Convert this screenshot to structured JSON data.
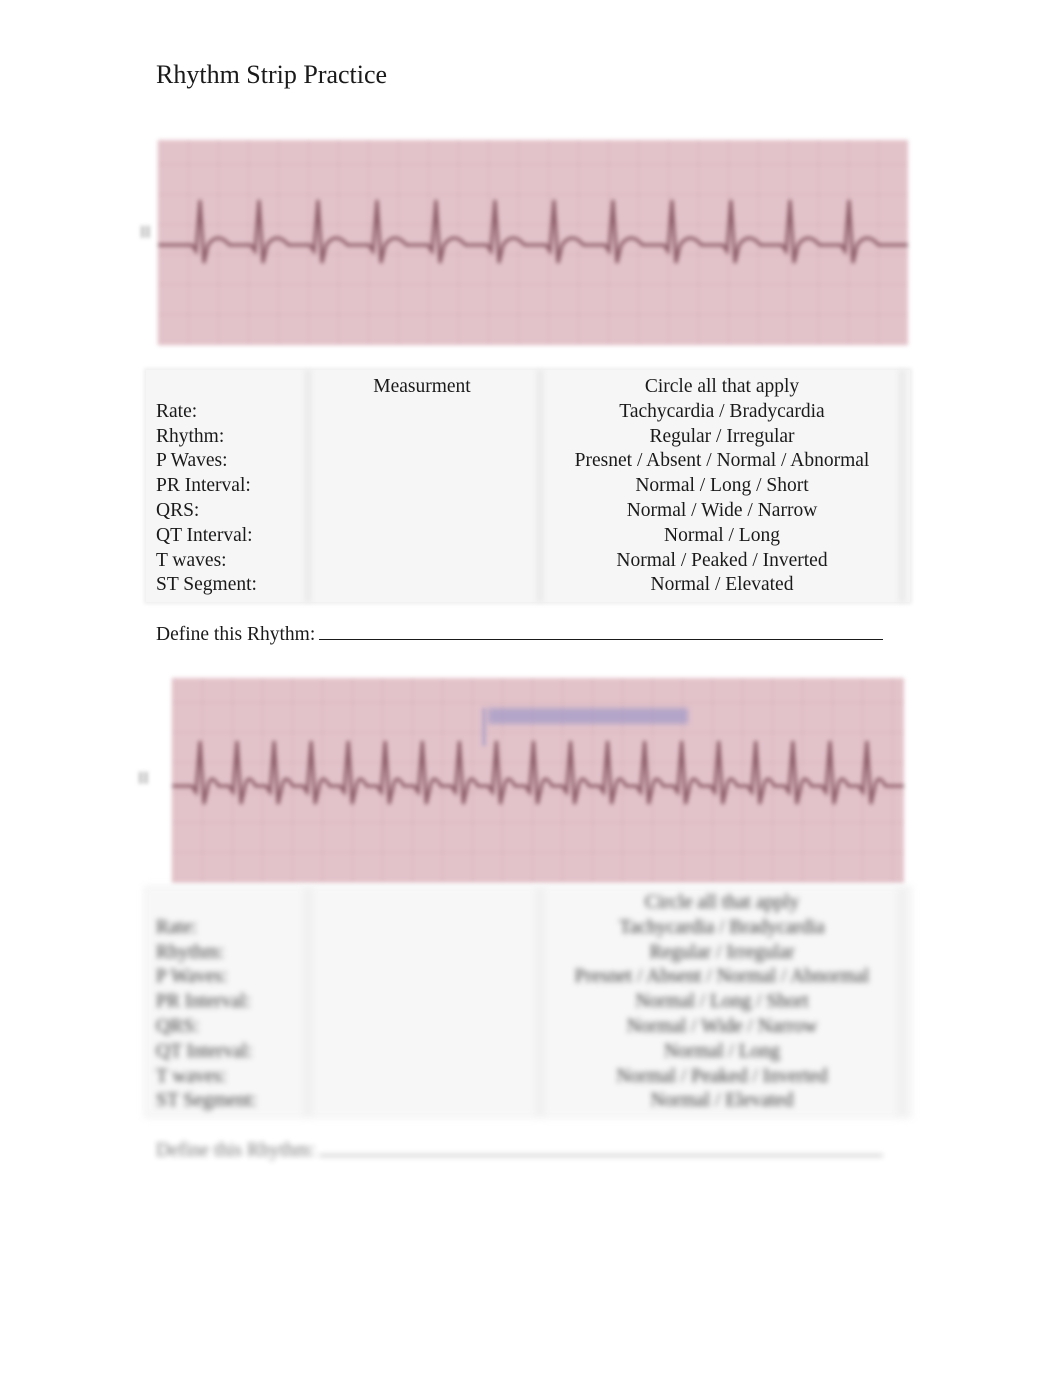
{
  "page": {
    "title": "Rhythm Strip Practice"
  },
  "strips": [
    {
      "lead_label": "II",
      "beats": 12,
      "annotation": ""
    },
    {
      "lead_label": "II",
      "beats": 19,
      "annotation": "(blurred annotation)"
    }
  ],
  "table": {
    "headers": [
      "",
      "Measurment",
      "Circle all that apply"
    ],
    "rows": [
      {
        "label": "Rate:",
        "measurement": "",
        "options": "Tachycardia / Bradycardia"
      },
      {
        "label": "Rhythm:",
        "measurement": "",
        "options": "Regular / Irregular"
      },
      {
        "label": "P Waves:",
        "measurement": "",
        "options": "Presnet / Absent / Normal / Abnormal"
      },
      {
        "label": "PR Interval:",
        "measurement": "",
        "options": "Normal / Long / Short"
      },
      {
        "label": "QRS:",
        "measurement": "",
        "options": "Normal / Wide / Narrow"
      },
      {
        "label": "QT Interval:",
        "measurement": "",
        "options": "Normal / Long"
      },
      {
        "label": "T waves:",
        "measurement": "",
        "options": "Normal / Peaked / Inverted"
      },
      {
        "label": "ST Segment:",
        "measurement": "",
        "options": "Normal / Elevated"
      }
    ]
  },
  "define": {
    "label": "Define this Rhythm:",
    "value": ""
  },
  "colors": {
    "strip_bg": "#e3c3ca",
    "trace": "#8a5a66",
    "annotation": "#8c8cc8",
    "table_bg": "#f6f6f6"
  }
}
